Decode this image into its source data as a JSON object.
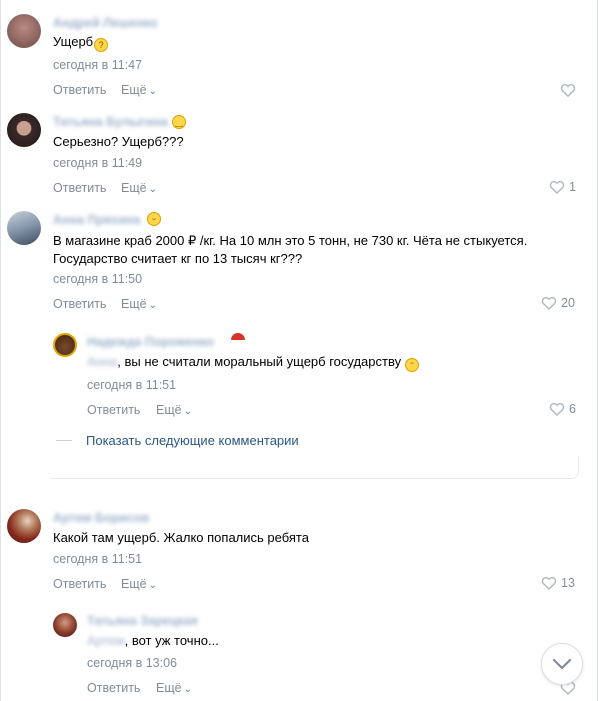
{
  "comments": [
    {
      "author": "Андрей Лешенко",
      "text": "Ущерб",
      "time": "сегодня в 11:47",
      "reply_label": "Ответить",
      "more_label": "Ещё",
      "likes": ""
    },
    {
      "author": "Татьяна Булыгина",
      "text": "Серьезно? Ущерб???",
      "time": "сегодня в 11:49",
      "reply_label": "Ответить",
      "more_label": "Ещё",
      "likes": "1"
    },
    {
      "author": "Анна Пряхина",
      "text_line1": "В магазине краб 2000 ₽ /кг. На 10 млн это 5 тонн, не 730 кг. Чёта не стыкуется.",
      "text_line2": "Государство считает кг по 13 тысяч кг???",
      "time": "сегодня в 11:50",
      "reply_label": "Ответить",
      "more_label": "Ещё",
      "likes": "20"
    },
    {
      "author": "Надежда Пороменко",
      "mention": "Анна",
      "text": ", вы не считали моральный ущерб государству",
      "time": "сегодня в 11:51",
      "reply_label": "Ответить",
      "more_label": "Ещё",
      "likes": "6"
    },
    {
      "author": "Артем Борисов",
      "text": "Какой там ущерб. Жалко попались ребята",
      "time": "сегодня в 11:51",
      "reply_label": "Ответить",
      "more_label": "Ещё",
      "likes": "13"
    },
    {
      "author": "Татьяна Зарецкая",
      "mention": "Артем",
      "text": ", вот уж точно...",
      "time": "сегодня в 13:06",
      "reply_label": "Ответить",
      "more_label": "Ещё",
      "likes": ""
    }
  ],
  "show_more_label": "Показать следующие комментарии",
  "colors": {
    "link": "#2a5885",
    "meta": "#818c99",
    "heart": "#aeb7c2"
  }
}
